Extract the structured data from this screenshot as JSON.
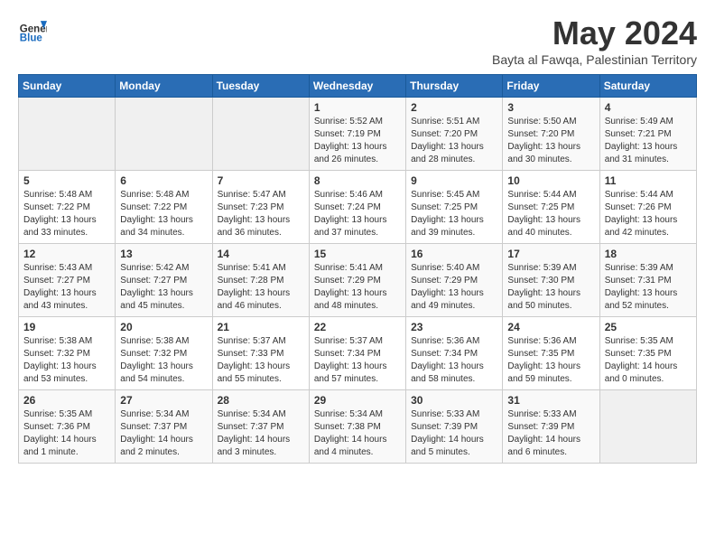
{
  "header": {
    "logo_general": "General",
    "logo_blue": "Blue",
    "month_title": "May 2024",
    "subtitle": "Bayta al Fawqa, Palestinian Territory"
  },
  "weekdays": [
    "Sunday",
    "Monday",
    "Tuesday",
    "Wednesday",
    "Thursday",
    "Friday",
    "Saturday"
  ],
  "weeks": [
    [
      {
        "day": "",
        "info": ""
      },
      {
        "day": "",
        "info": ""
      },
      {
        "day": "",
        "info": ""
      },
      {
        "day": "1",
        "info": "Sunrise: 5:52 AM\nSunset: 7:19 PM\nDaylight: 13 hours\nand 26 minutes."
      },
      {
        "day": "2",
        "info": "Sunrise: 5:51 AM\nSunset: 7:20 PM\nDaylight: 13 hours\nand 28 minutes."
      },
      {
        "day": "3",
        "info": "Sunrise: 5:50 AM\nSunset: 7:20 PM\nDaylight: 13 hours\nand 30 minutes."
      },
      {
        "day": "4",
        "info": "Sunrise: 5:49 AM\nSunset: 7:21 PM\nDaylight: 13 hours\nand 31 minutes."
      }
    ],
    [
      {
        "day": "5",
        "info": "Sunrise: 5:48 AM\nSunset: 7:22 PM\nDaylight: 13 hours\nand 33 minutes."
      },
      {
        "day": "6",
        "info": "Sunrise: 5:48 AM\nSunset: 7:22 PM\nDaylight: 13 hours\nand 34 minutes."
      },
      {
        "day": "7",
        "info": "Sunrise: 5:47 AM\nSunset: 7:23 PM\nDaylight: 13 hours\nand 36 minutes."
      },
      {
        "day": "8",
        "info": "Sunrise: 5:46 AM\nSunset: 7:24 PM\nDaylight: 13 hours\nand 37 minutes."
      },
      {
        "day": "9",
        "info": "Sunrise: 5:45 AM\nSunset: 7:25 PM\nDaylight: 13 hours\nand 39 minutes."
      },
      {
        "day": "10",
        "info": "Sunrise: 5:44 AM\nSunset: 7:25 PM\nDaylight: 13 hours\nand 40 minutes."
      },
      {
        "day": "11",
        "info": "Sunrise: 5:44 AM\nSunset: 7:26 PM\nDaylight: 13 hours\nand 42 minutes."
      }
    ],
    [
      {
        "day": "12",
        "info": "Sunrise: 5:43 AM\nSunset: 7:27 PM\nDaylight: 13 hours\nand 43 minutes."
      },
      {
        "day": "13",
        "info": "Sunrise: 5:42 AM\nSunset: 7:27 PM\nDaylight: 13 hours\nand 45 minutes."
      },
      {
        "day": "14",
        "info": "Sunrise: 5:41 AM\nSunset: 7:28 PM\nDaylight: 13 hours\nand 46 minutes."
      },
      {
        "day": "15",
        "info": "Sunrise: 5:41 AM\nSunset: 7:29 PM\nDaylight: 13 hours\nand 48 minutes."
      },
      {
        "day": "16",
        "info": "Sunrise: 5:40 AM\nSunset: 7:29 PM\nDaylight: 13 hours\nand 49 minutes."
      },
      {
        "day": "17",
        "info": "Sunrise: 5:39 AM\nSunset: 7:30 PM\nDaylight: 13 hours\nand 50 minutes."
      },
      {
        "day": "18",
        "info": "Sunrise: 5:39 AM\nSunset: 7:31 PM\nDaylight: 13 hours\nand 52 minutes."
      }
    ],
    [
      {
        "day": "19",
        "info": "Sunrise: 5:38 AM\nSunset: 7:32 PM\nDaylight: 13 hours\nand 53 minutes."
      },
      {
        "day": "20",
        "info": "Sunrise: 5:38 AM\nSunset: 7:32 PM\nDaylight: 13 hours\nand 54 minutes."
      },
      {
        "day": "21",
        "info": "Sunrise: 5:37 AM\nSunset: 7:33 PM\nDaylight: 13 hours\nand 55 minutes."
      },
      {
        "day": "22",
        "info": "Sunrise: 5:37 AM\nSunset: 7:34 PM\nDaylight: 13 hours\nand 57 minutes."
      },
      {
        "day": "23",
        "info": "Sunrise: 5:36 AM\nSunset: 7:34 PM\nDaylight: 13 hours\nand 58 minutes."
      },
      {
        "day": "24",
        "info": "Sunrise: 5:36 AM\nSunset: 7:35 PM\nDaylight: 13 hours\nand 59 minutes."
      },
      {
        "day": "25",
        "info": "Sunrise: 5:35 AM\nSunset: 7:35 PM\nDaylight: 14 hours\nand 0 minutes."
      }
    ],
    [
      {
        "day": "26",
        "info": "Sunrise: 5:35 AM\nSunset: 7:36 PM\nDaylight: 14 hours\nand 1 minute."
      },
      {
        "day": "27",
        "info": "Sunrise: 5:34 AM\nSunset: 7:37 PM\nDaylight: 14 hours\nand 2 minutes."
      },
      {
        "day": "28",
        "info": "Sunrise: 5:34 AM\nSunset: 7:37 PM\nDaylight: 14 hours\nand 3 minutes."
      },
      {
        "day": "29",
        "info": "Sunrise: 5:34 AM\nSunset: 7:38 PM\nDaylight: 14 hours\nand 4 minutes."
      },
      {
        "day": "30",
        "info": "Sunrise: 5:33 AM\nSunset: 7:39 PM\nDaylight: 14 hours\nand 5 minutes."
      },
      {
        "day": "31",
        "info": "Sunrise: 5:33 AM\nSunset: 7:39 PM\nDaylight: 14 hours\nand 6 minutes."
      },
      {
        "day": "",
        "info": ""
      }
    ]
  ]
}
